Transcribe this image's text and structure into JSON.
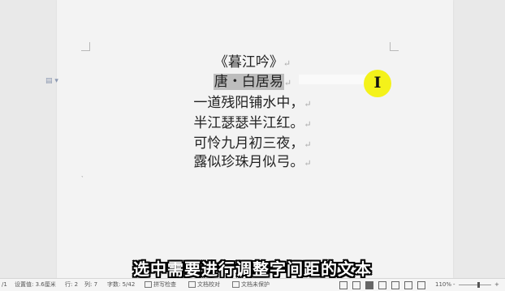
{
  "document": {
    "lines": [
      {
        "text": "《暮江吟》"
      },
      {
        "text": "唐・白居易"
      },
      {
        "text": "一道残阳铺水中，"
      },
      {
        "text": "半江瑟瑟半江红。"
      },
      {
        "text": "可怜九月初三夜，"
      },
      {
        "text": "露似珍珠月似弓。"
      }
    ],
    "paragraph_mark": "↵"
  },
  "cursor_glyph": "I",
  "subtitle": "选中需要进行调整字间距的文本",
  "statusbar": {
    "page": "/1",
    "setting": "设置值: 3.6厘米",
    "row": "行: 2",
    "col": "列: 7",
    "wordcount": "字数: 5/42",
    "spellcheck": "拼写检查",
    "doc_proof": "文档校对",
    "doc_protect": "文档未保护",
    "zoom": "110%",
    "zoom_minus": "-",
    "zoom_plus": "+"
  },
  "colors": {
    "highlight": "#f4f21a",
    "selection": "#bdbdbd",
    "subtitle_text": "#ffffff"
  }
}
